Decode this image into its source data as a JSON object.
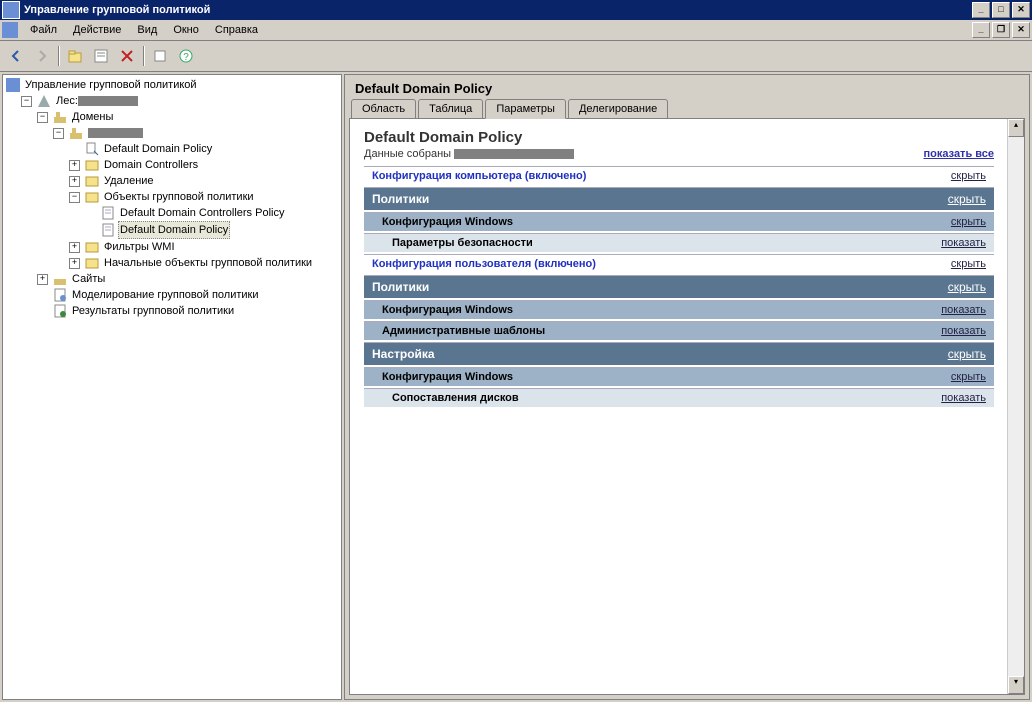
{
  "window_title": "Управление групповой политикой",
  "menu": [
    "Файл",
    "Действие",
    "Вид",
    "Окно",
    "Справка"
  ],
  "tree": {
    "root": "Управление групповой политикой",
    "forest": "Лес:",
    "domains": "Домены",
    "ddp": "Default Domain Policy",
    "dc": "Domain Controllers",
    "del": "Удаление",
    "gpo_objects": "Объекты групповой политики",
    "ddcp": "Default Domain Controllers Policy",
    "ddp2": "Default Domain Policy",
    "wmi": "Фильтры WMI",
    "starter": "Начальные объекты групповой политики",
    "sites": "Сайты",
    "modeling": "Моделирование групповой политики",
    "results": "Результаты групповой политики"
  },
  "detail": {
    "title": "Default Domain Policy",
    "tabs": [
      "Область",
      "Таблица",
      "Параметры",
      "Делегирование"
    ],
    "active_tab": 2,
    "report_title": "Default Domain Policy",
    "data_collected": "Данные собраны",
    "show_all": "показать все",
    "rows": [
      {
        "text": "Конфигурация компьютера (включено)",
        "cls": "c-config",
        "action": "скрыть",
        "indent": 0
      },
      {
        "text": "Политики",
        "cls": "c-darksteel",
        "action": "скрыть",
        "indent": 1
      },
      {
        "text": "Конфигурация Windows",
        "cls": "c-steel",
        "action": "скрыть",
        "indent": 2
      },
      {
        "text": "Параметры безопасности",
        "cls": "c-light",
        "action": "показать",
        "indent": 3
      },
      {
        "text": "Конфигурация пользователя (включено)",
        "cls": "c-config",
        "action": "скрыть",
        "indent": 0
      },
      {
        "text": "Политики",
        "cls": "c-darksteel",
        "action": "скрыть",
        "indent": 1
      },
      {
        "text": "Конфигурация Windows",
        "cls": "c-steel",
        "action": "показать",
        "indent": 2
      },
      {
        "text": "Административные шаблоны",
        "cls": "c-steel",
        "action": "показать",
        "indent": 2
      },
      {
        "text": "Настройка",
        "cls": "c-darksteel",
        "action": "скрыть",
        "indent": 1
      },
      {
        "text": "Конфигурация Windows",
        "cls": "c-steel",
        "action": "скрыть",
        "indent": 2
      },
      {
        "text": "Сопоставления дисков",
        "cls": "c-light",
        "action": "показать",
        "indent": 3
      }
    ]
  }
}
